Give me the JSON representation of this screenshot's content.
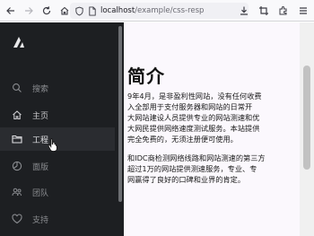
{
  "browser": {
    "url_host": "localhost",
    "url_path": "/example/css-resp",
    "icons": {
      "back": "back-arrow-icon",
      "forward": "forward-arrow-icon",
      "reload": "reload-icon",
      "home": "home-icon",
      "shield": "shield-icon",
      "page": "page-icon",
      "download": "download-icon",
      "crop": "crop-icon",
      "extensions": "extensions-icon",
      "menu": "hamburger-menu-icon"
    }
  },
  "sidebar": {
    "logo": "logo-icon",
    "items": [
      {
        "label": "搜索",
        "icon": "search-icon"
      },
      {
        "label": "主页",
        "icon": "home-icon"
      },
      {
        "label": "工程",
        "icon": "folder-icon"
      },
      {
        "label": "面版",
        "icon": "chart-icon"
      },
      {
        "label": "团队",
        "icon": "team-icon"
      },
      {
        "label": "支持",
        "icon": "support-icon"
      }
    ]
  },
  "content": {
    "heading": "简介",
    "paragraph1": [
      "9年4月，是非盈利性网站，没有任何收费",
      "入全部用于支付服务器和网站的日常开",
      "大网站建设人员提供专业的网站测速和优",
      "大网民提供网络速度测试服务。本站提供",
      "完全免费的，无须注册便可使用。"
    ],
    "paragraph2": [
      "和IDC商检测网络线路和网站测速的第三方",
      "超过1万的网站提供测速服务，专业、专",
      "网赢得了良好的口碑和业界的肯定。"
    ]
  }
}
